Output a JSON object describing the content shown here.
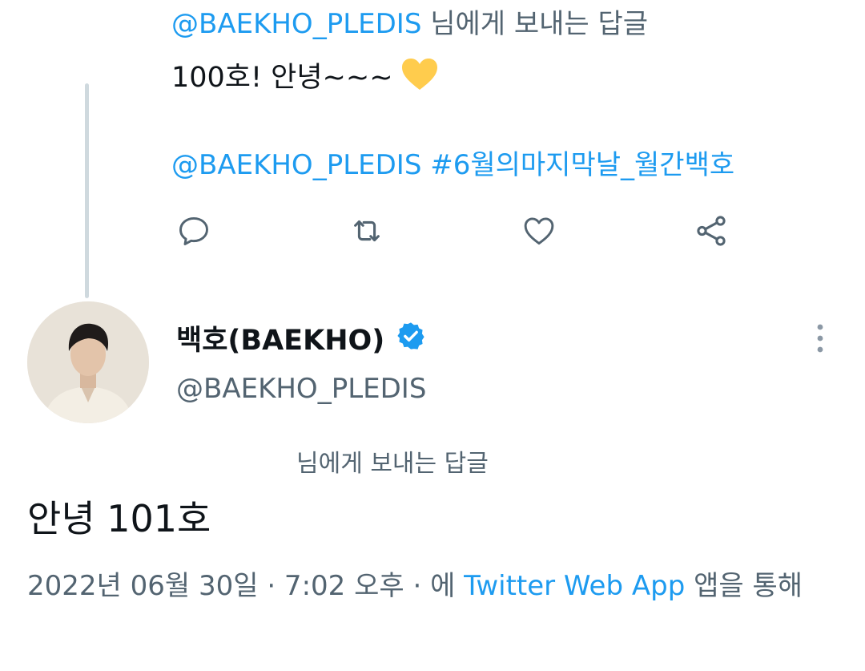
{
  "parent_tweet": {
    "reply_to": {
      "mention": "@BAEKHO_PLEDIS",
      "suffix": " 님에게 보내는 답글"
    },
    "text": "100호! 안녕~~~",
    "tags": "@BAEKHO_PLEDIS #6월의마지막날_월간백호",
    "actions": {
      "reply": "reply-icon",
      "retweet": "retweet-icon",
      "like": "heart-outline-icon",
      "share": "share-icon"
    }
  },
  "main_tweet": {
    "author": {
      "display_name": "백호(BAEKHO)",
      "handle": "@BAEKHO_PLEDIS",
      "verified": true
    },
    "reply_to_label": "님에게 보내는 답글",
    "text": "안녕 101호",
    "timestamp": "2022년 06월 30일 · 7:02 오후 · 에 ",
    "app_name": "Twitter Web App",
    "app_suffix": " 앱을 통해"
  },
  "colors": {
    "accent": "#1d9bf0",
    "text_primary": "#0f1419",
    "text_secondary": "#536471",
    "icon_gray": "#536471",
    "thread_line": "#cfd9de",
    "emoji_heart": "#ffcc4d"
  }
}
